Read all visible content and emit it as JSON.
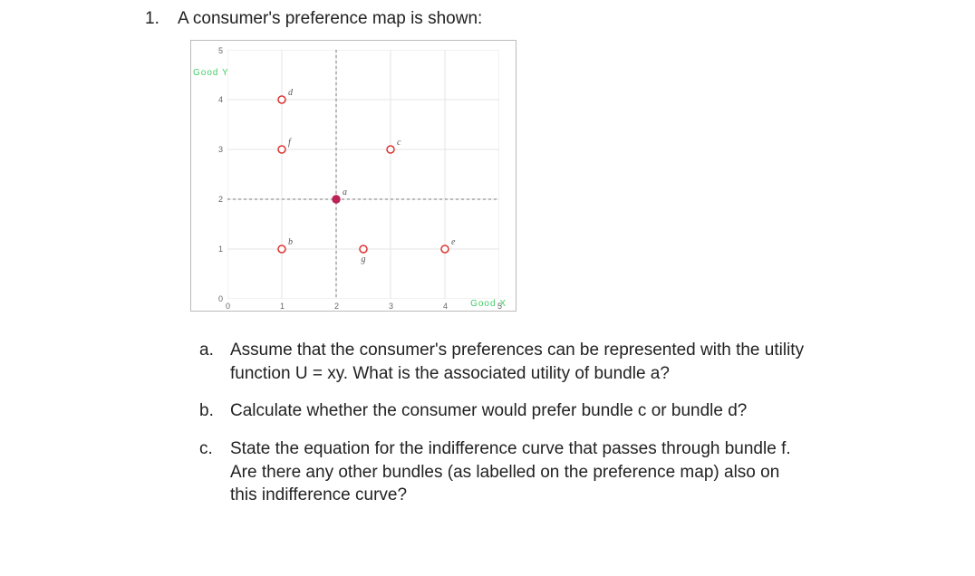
{
  "question": {
    "number": "1.",
    "intro": "A consumer's preference map is shown:",
    "sub": [
      {
        "n": "a.",
        "text": "Assume that the consumer's preferences can be represented with the utility function U = xy. What is the associated utility of bundle a?"
      },
      {
        "n": "b.",
        "text": "Calculate whether the consumer would prefer bundle c or bundle d?"
      },
      {
        "n": "c.",
        "text": "State the equation for the indifference curve that passes through bundle f. Are there any other bundles (as labelled on the preference map) also on this indifference curve?"
      }
    ]
  },
  "chart_data": {
    "type": "scatter",
    "title": "",
    "xlabel": "Good X",
    "ylabel": "Good Y",
    "xlim": [
      0,
      5
    ],
    "ylim": [
      0,
      5
    ],
    "xticks": [
      0,
      1,
      2,
      3,
      4,
      5
    ],
    "yticks": [
      0,
      1,
      2,
      3,
      4,
      5
    ],
    "crosshair": {
      "x": 2,
      "y": 2
    },
    "points": [
      {
        "label": "a",
        "x": 2,
        "y": 2,
        "center": true
      },
      {
        "label": "b",
        "x": 1,
        "y": 1
      },
      {
        "label": "c",
        "x": 3,
        "y": 3
      },
      {
        "label": "d",
        "x": 1,
        "y": 4
      },
      {
        "label": "e",
        "x": 4,
        "y": 1
      },
      {
        "label": "f",
        "x": 1,
        "y": 3
      },
      {
        "label": "g",
        "x": 2.5,
        "y": 1,
        "labelBelow": true
      }
    ]
  }
}
